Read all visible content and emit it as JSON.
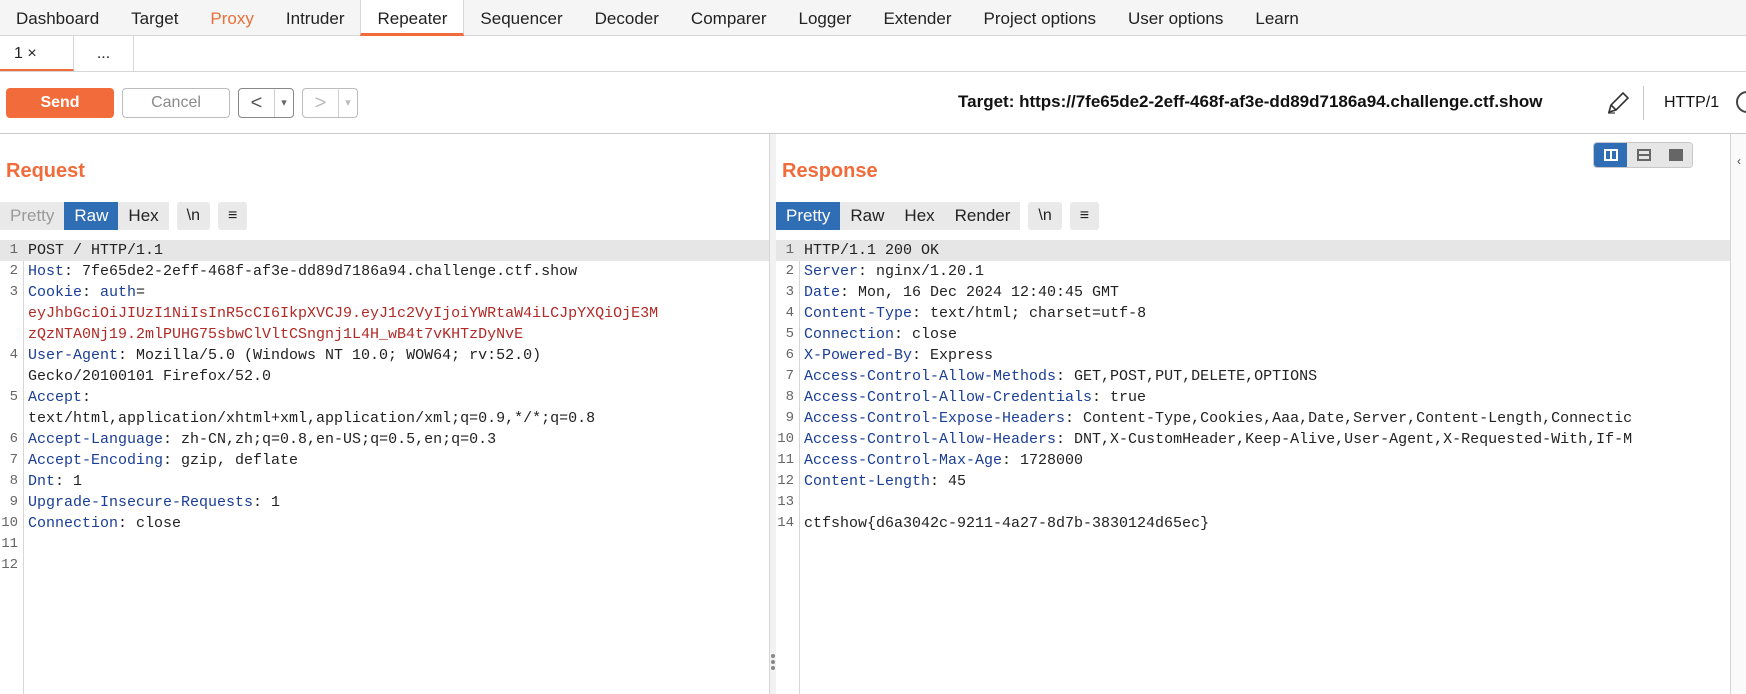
{
  "top_tabs": [
    "Dashboard",
    "Target",
    "Proxy",
    "Intruder",
    "Repeater",
    "Sequencer",
    "Decoder",
    "Comparer",
    "Logger",
    "Extender",
    "Project options",
    "User options",
    "Learn"
  ],
  "sub_tabs": {
    "first": "1  ×",
    "more": "..."
  },
  "toolbar": {
    "send": "Send",
    "cancel": "Cancel",
    "back": "<",
    "forward": ">",
    "dropdown": "▾",
    "target": "Target: https://7fe65de2-2eff-468f-af3e-dd89d7186a94.challenge.ctf.show",
    "http_version": "HTTP/1"
  },
  "request": {
    "title": "Request",
    "tabs": [
      "Pretty",
      "Raw",
      "Hex"
    ],
    "newline_btn": "\\n",
    "menu_btn": "≡",
    "lines": [
      {
        "n": "1",
        "parts": [
          [
            "",
            "POST / HTTP/1.1"
          ]
        ]
      },
      {
        "n": "2",
        "parts": [
          [
            "k",
            "Host"
          ],
          [
            "",
            ": 7fe65de2-2eff-468f-af3e-dd89d7186a94.challenge.ctf.show"
          ]
        ]
      },
      {
        "n": "3",
        "parts": [
          [
            "k",
            "Cookie"
          ],
          [
            "",
            ": "
          ],
          [
            "k",
            "auth"
          ],
          [
            "",
            "="
          ]
        ]
      },
      {
        "n": "",
        "parts": [
          [
            "r",
            "eyJhbGciOiJIUzI1NiIsInR5cCI6IkpXVCJ9.eyJ1c2VyIjoiYWRtaW4iLCJpYXQiOjE3M"
          ]
        ]
      },
      {
        "n": "",
        "parts": [
          [
            "r",
            "zQzNTA0Nj19.2mlPUHG75sbwClVltCSngnj1L4H_wB4t7vKHTzDyNvE"
          ]
        ]
      },
      {
        "n": "4",
        "parts": [
          [
            "k",
            "User-Agent"
          ],
          [
            "",
            ": Mozilla/5.0 (Windows NT 10.0; WOW64; rv:52.0)"
          ]
        ]
      },
      {
        "n": "",
        "parts": [
          [
            "",
            "Gecko/20100101 Firefox/52.0"
          ]
        ]
      },
      {
        "n": "5",
        "parts": [
          [
            "k",
            "Accept"
          ],
          [
            "",
            ":"
          ]
        ]
      },
      {
        "n": "",
        "parts": [
          [
            "",
            "text/html,application/xhtml+xml,application/xml;q=0.9,*/*;q=0.8"
          ]
        ]
      },
      {
        "n": "6",
        "parts": [
          [
            "k",
            "Accept-Language"
          ],
          [
            "",
            ": zh-CN,zh;q=0.8,en-US;q=0.5,en;q=0.3"
          ]
        ]
      },
      {
        "n": "7",
        "parts": [
          [
            "k",
            "Accept-Encoding"
          ],
          [
            "",
            ": gzip, deflate"
          ]
        ]
      },
      {
        "n": "8",
        "parts": [
          [
            "k",
            "Dnt"
          ],
          [
            "",
            ": 1"
          ]
        ]
      },
      {
        "n": "9",
        "parts": [
          [
            "k",
            "Upgrade-Insecure-Requests"
          ],
          [
            "",
            ": 1"
          ]
        ]
      },
      {
        "n": "10",
        "parts": [
          [
            "k",
            "Connection"
          ],
          [
            "",
            ": close"
          ]
        ]
      },
      {
        "n": "11",
        "parts": [
          [
            "",
            ""
          ]
        ]
      },
      {
        "n": "12",
        "parts": [
          [
            "",
            ""
          ]
        ]
      }
    ]
  },
  "response": {
    "title": "Response",
    "tabs": [
      "Pretty",
      "Raw",
      "Hex",
      "Render"
    ],
    "newline_btn": "\\n",
    "menu_btn": "≡",
    "lines": [
      {
        "n": "1",
        "parts": [
          [
            "",
            "HTTP/1.1 200 OK"
          ]
        ]
      },
      {
        "n": "2",
        "parts": [
          [
            "k",
            "Server"
          ],
          [
            "",
            ": nginx/1.20.1"
          ]
        ]
      },
      {
        "n": "3",
        "parts": [
          [
            "k",
            "Date"
          ],
          [
            "",
            ": Mon, 16 Dec 2024 12:40:45 GMT"
          ]
        ]
      },
      {
        "n": "4",
        "parts": [
          [
            "k",
            "Content-Type"
          ],
          [
            "",
            ": text/html; charset=utf-8"
          ]
        ]
      },
      {
        "n": "5",
        "parts": [
          [
            "k",
            "Connection"
          ],
          [
            "",
            ": close"
          ]
        ]
      },
      {
        "n": "6",
        "parts": [
          [
            "k",
            "X-Powered-By"
          ],
          [
            "",
            ": Express"
          ]
        ]
      },
      {
        "n": "7",
        "parts": [
          [
            "k",
            "Access-Control-Allow-Methods"
          ],
          [
            "",
            ": GET,POST,PUT,DELETE,OPTIONS"
          ]
        ]
      },
      {
        "n": "8",
        "parts": [
          [
            "k",
            "Access-Control-Allow-Credentials"
          ],
          [
            "",
            ": true"
          ]
        ]
      },
      {
        "n": "9",
        "parts": [
          [
            "k",
            "Access-Control-Expose-Headers"
          ],
          [
            "",
            ": Content-Type,Cookies,Aaa,Date,Server,Content-Length,Connectic"
          ]
        ]
      },
      {
        "n": "10",
        "parts": [
          [
            "k",
            "Access-Control-Allow-Headers"
          ],
          [
            "",
            ": DNT,X-CustomHeader,Keep-Alive,User-Agent,X-Requested-With,If-M"
          ]
        ]
      },
      {
        "n": "11",
        "parts": [
          [
            "k",
            "Access-Control-Max-Age"
          ],
          [
            "",
            ": 1728000"
          ]
        ]
      },
      {
        "n": "12",
        "parts": [
          [
            "k",
            "Content-Length"
          ],
          [
            "",
            ": 45"
          ]
        ]
      },
      {
        "n": "13",
        "parts": [
          [
            "",
            ""
          ]
        ]
      },
      {
        "n": "14",
        "parts": [
          [
            "",
            "ctfshow{d6a3042c-9211-4a27-8d7b-3830124d65ec}"
          ]
        ]
      }
    ]
  },
  "colors": {
    "accent": "#f26b3a",
    "selected_tab": "#2f6db4",
    "header_key": "#1a3e96",
    "cookie_value": "#b02a26"
  }
}
